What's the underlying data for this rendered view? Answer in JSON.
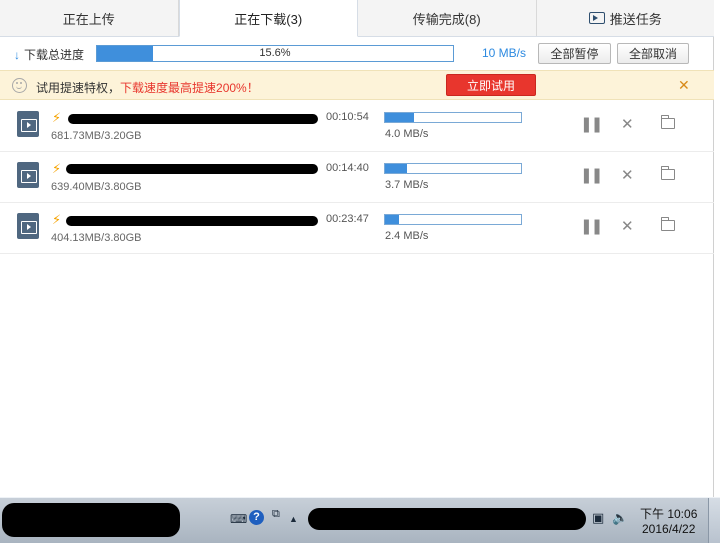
{
  "tabs": [
    {
      "label": "正在上传"
    },
    {
      "label": "正在下载(3)"
    },
    {
      "label": "传输完成(8)"
    },
    {
      "label": "推送任务"
    }
  ],
  "progress": {
    "label": "下载总进度",
    "percent_text": "15.6%",
    "percent": 15.6,
    "speed": "10 MB/s",
    "pause_all": "全部暂停",
    "cancel_all": "全部取消"
  },
  "promo": {
    "text": "试用提速特权，",
    "highlight": "下载速度最高提速200%！",
    "button": "立即试用"
  },
  "downloads": [
    {
      "time": "00:10:54",
      "size": "681.73MB/3.20GB",
      "speed": "4.0 MB/s",
      "progress": 0.21
    },
    {
      "time": "00:14:40",
      "size": "639.40MB/3.80GB",
      "speed": "3.7 MB/s",
      "progress": 0.16
    },
    {
      "time": "00:23:47",
      "size": "404.13MB/3.80GB",
      "speed": "2.4 MB/s",
      "progress": 0.1
    }
  ],
  "taskbar": {
    "time": "下午 10:06",
    "date": "2016/4/22"
  },
  "colors": {
    "accent": "#3f8fdc",
    "trial_button": "#e8362d",
    "promo_bg": "#fdf3d9"
  }
}
